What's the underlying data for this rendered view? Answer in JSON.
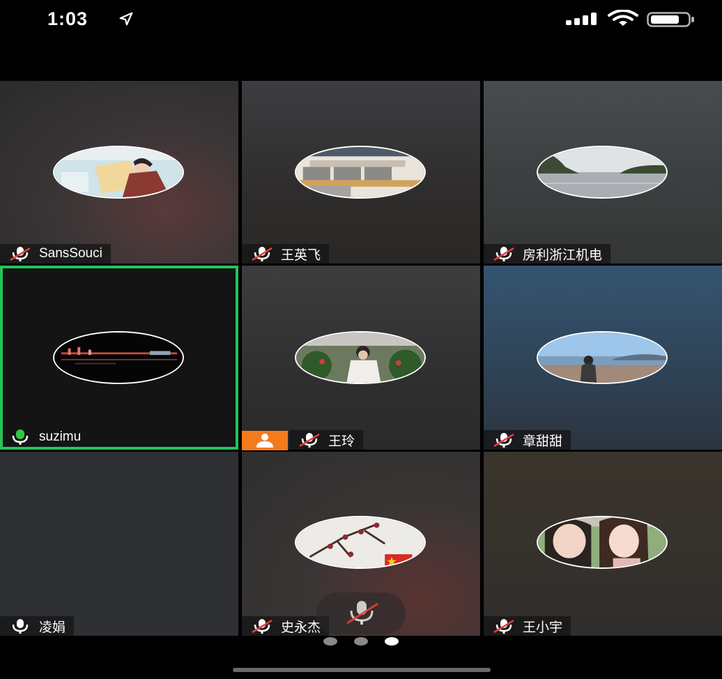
{
  "status_bar": {
    "time": "1:03",
    "icons": [
      "location-arrow-icon",
      "cellular-signal-icon",
      "wifi-icon",
      "battery-icon"
    ]
  },
  "participants": [
    {
      "name": "SansSouci",
      "mic": "muted",
      "avatar": "illustration-woman-reading"
    },
    {
      "name": "王英飞",
      "mic": "muted",
      "avatar": "office-chairs"
    },
    {
      "name": "房利浙江机电",
      "mic": "muted",
      "avatar": "lake-landscape"
    },
    {
      "name": "suzimu",
      "mic": "speaking",
      "avatar": "night-city-river",
      "active_speaker": true
    },
    {
      "name": "王玲",
      "mic": "muted",
      "avatar": "woman-with-flowers",
      "host": true
    },
    {
      "name": "章甜甜",
      "mic": "muted",
      "avatar": "girl-at-seaside"
    },
    {
      "name": "凌娟",
      "mic": "on",
      "avatar": null
    },
    {
      "name": "史永杰",
      "mic": "muted",
      "avatar": "plum-blossom-flag"
    },
    {
      "name": "王小宇",
      "mic": "muted",
      "avatar": "two-women-selfie"
    }
  ],
  "pager": {
    "pages": 3,
    "current_page": 3
  },
  "colors": {
    "active_border": "#25c45a",
    "speaking_mic": "#2ecc40",
    "muted_slash": "#e0413a",
    "host_badge": "#f37b1d"
  }
}
